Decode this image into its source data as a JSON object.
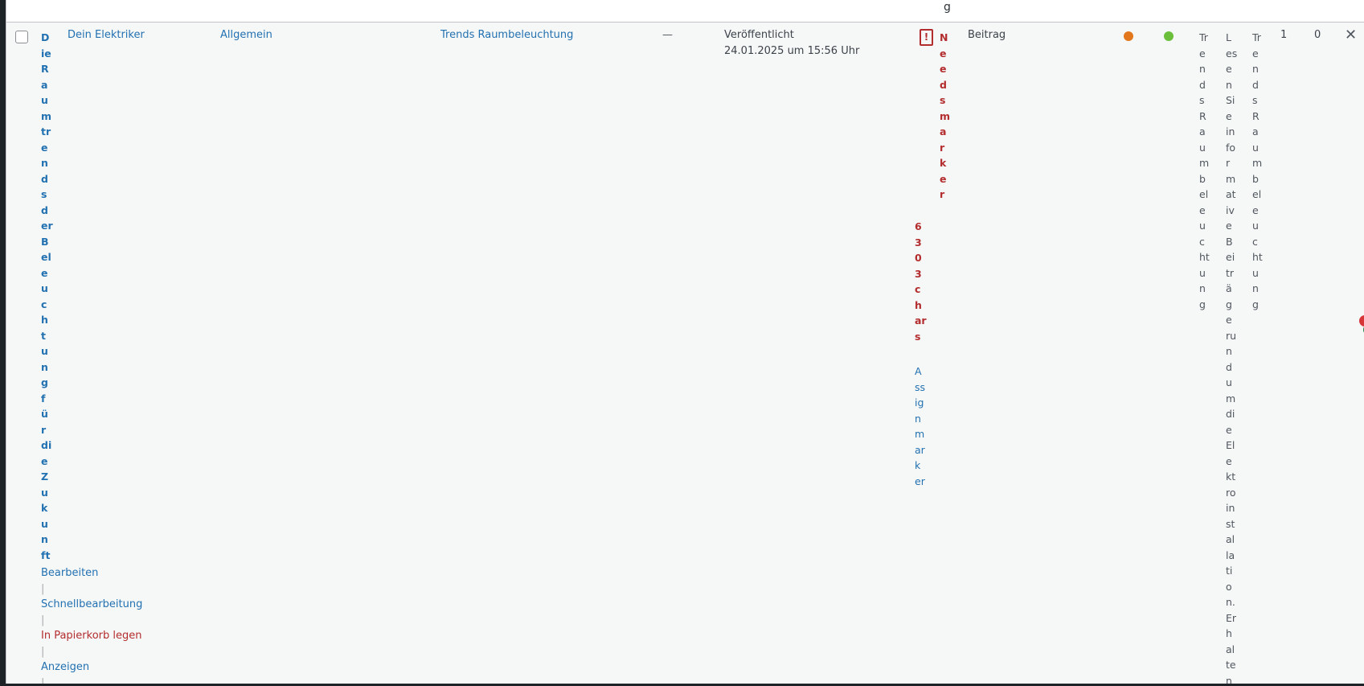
{
  "header": {
    "char": "g"
  },
  "row": {
    "title_chars": [
      "D",
      "ie",
      "R",
      "a",
      "u",
      "m",
      "tr",
      "e",
      "n",
      "d",
      "s",
      "d",
      "er",
      "B",
      "el",
      "e",
      "u",
      "c",
      "h",
      "t",
      "u",
      "n",
      "g",
      "f",
      "ü",
      "r",
      "di",
      "e",
      "Z",
      "u",
      "k",
      "u",
      "n",
      "ft"
    ],
    "author": "Dein Elektriker",
    "category": "Allgemein",
    "tag": "Trends Raumbeleuchtung",
    "dash": "—",
    "status": "Veröffentlicht",
    "date": "24.01.2025 um 15:56 Uhr",
    "warning_icon": "!",
    "warning_chars_1": [
      "N",
      "e",
      "e",
      "d",
      "s",
      "m",
      "a",
      "r",
      "k",
      "e",
      "r"
    ],
    "warning_chars_2": [
      "6",
      "3",
      "0",
      "3",
      "c",
      "h",
      "ar",
      "s"
    ],
    "assign_chars": [
      "A",
      "ss",
      "ig",
      "n",
      "m",
      "ar",
      "k",
      "er"
    ],
    "type": "Beitrag",
    "col_v1": [
      "Tr",
      "e",
      "n",
      "d",
      "s",
      "R",
      "a",
      "u",
      "m",
      "b",
      "el",
      "e",
      "u",
      "c",
      "ht",
      "u",
      "n",
      "g"
    ],
    "col_v2": [
      "L",
      "es",
      "e",
      "n",
      "Si",
      "e",
      "in",
      "fo",
      "r",
      "m",
      "at",
      "iv",
      "e",
      "B",
      "ei",
      "tr",
      "ä",
      "g",
      "e",
      "ru",
      "n",
      "d",
      "u",
      "m",
      "di",
      "e",
      "El",
      "e",
      "kt",
      "ro",
      "in",
      "st",
      "al",
      "la",
      "ti",
      "o",
      "n.",
      "Er",
      "h",
      "al",
      "te",
      "n"
    ],
    "col_v3": [
      "Tr",
      "e",
      "n",
      "d",
      "s",
      "R",
      "a",
      "u",
      "m",
      "b",
      "el",
      "e",
      "u",
      "c",
      "ht",
      "u",
      "n",
      "g"
    ],
    "num1": "1",
    "num2": "0",
    "close_icon": "✕",
    "actions": {
      "edit": "Bearbeiten",
      "quick_edit": "Schnellbearbeitung",
      "trash": "In Papierkorb legen",
      "view": "Anzeigen",
      "separator": "|"
    }
  },
  "colors": {
    "link": "#2271b1",
    "danger": "#b32d2e",
    "orange_dot": "#e2781b",
    "green_dot": "#6bbf3a"
  }
}
